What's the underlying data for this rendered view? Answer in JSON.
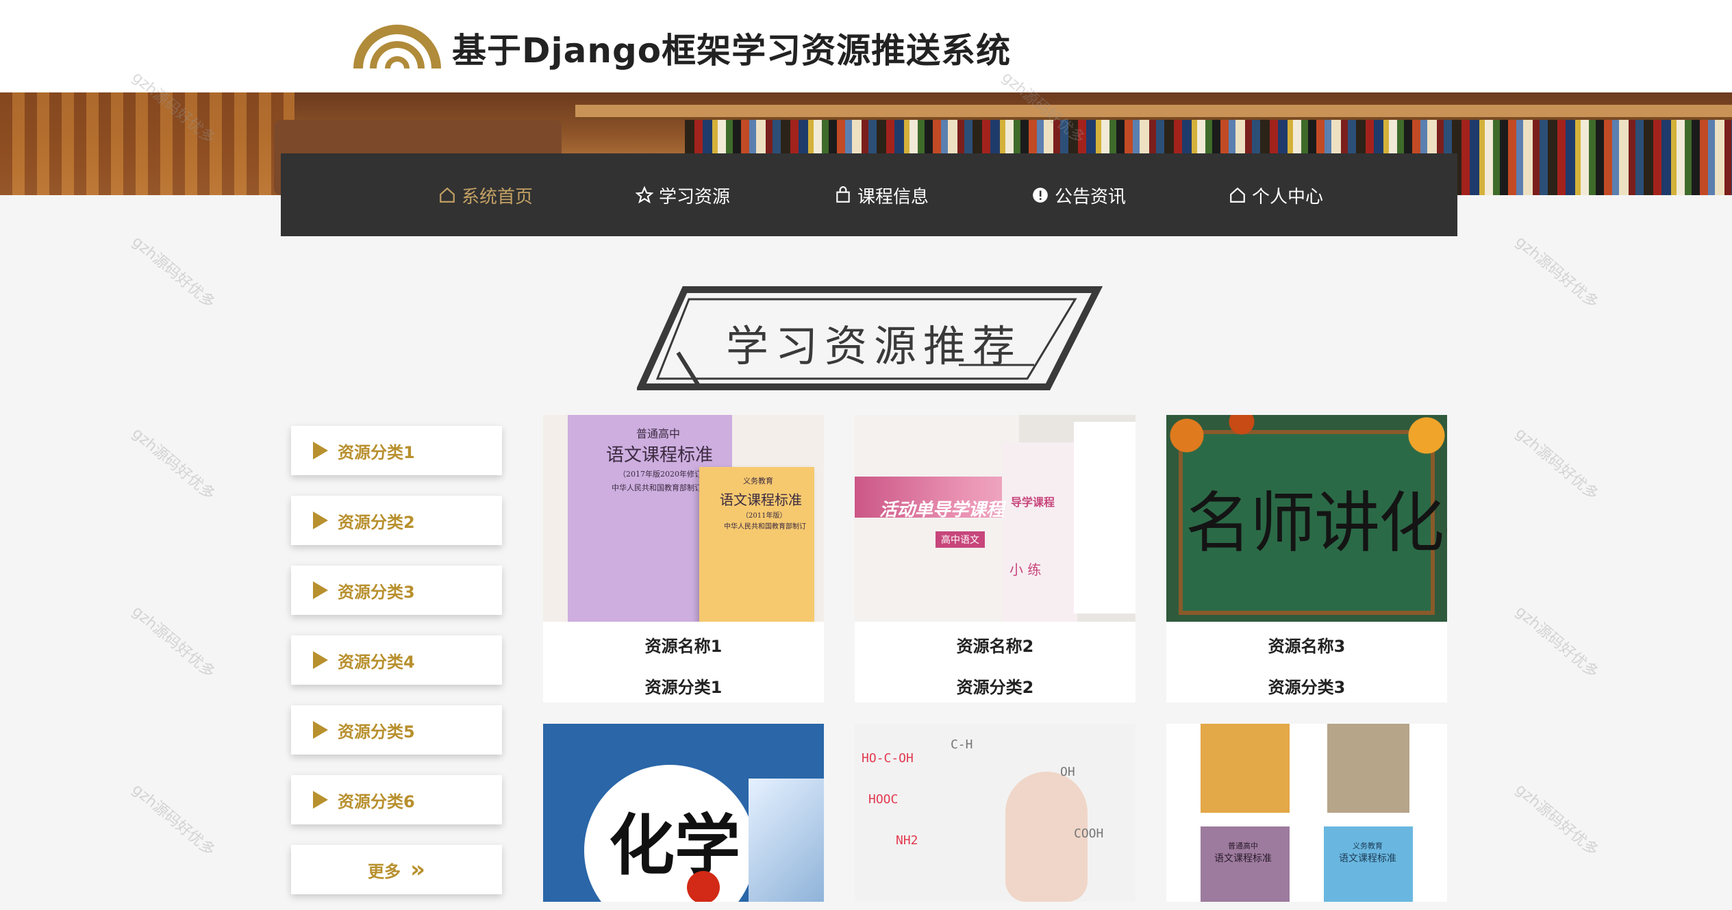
{
  "header": {
    "site_title": "基于Django框架学习资源推送系统"
  },
  "nav": {
    "items": [
      {
        "label": "系统首页",
        "icon": "home-icon",
        "active": true
      },
      {
        "label": "学习资源",
        "icon": "star-icon",
        "active": false
      },
      {
        "label": "课程信息",
        "icon": "bag-icon",
        "active": false
      },
      {
        "label": "公告资讯",
        "icon": "alert-circle-icon",
        "active": false
      },
      {
        "label": "个人中心",
        "icon": "home-icon",
        "active": false
      }
    ]
  },
  "section": {
    "title": "学习资源推荐"
  },
  "sidebar": {
    "items": [
      {
        "label": "资源分类1"
      },
      {
        "label": "资源分类2"
      },
      {
        "label": "资源分类3"
      },
      {
        "label": "资源分类4"
      },
      {
        "label": "资源分类5"
      },
      {
        "label": "资源分类6"
      }
    ],
    "more_label": "更多"
  },
  "cards": [
    {
      "name": "资源名称1",
      "category": "资源分类1",
      "image": {
        "book_a_lines": [
          "普通高中",
          "语文课程标准",
          "（2017年版2020年修订）",
          "中华人民共和国教育部制订"
        ],
        "book_b_lines": [
          "义务教育",
          "语文课程标准",
          "（2011年版）",
          "中华人民共和国教育部制订"
        ]
      }
    },
    {
      "name": "资源名称2",
      "category": "资源分类2",
      "image": {
        "cover_title": "活动单导学课程",
        "cover_sub": "高中语文",
        "right_title": "导学课程",
        "right_sub": "小 练"
      }
    },
    {
      "name": "资源名称3",
      "category": "资源分类3",
      "image": {
        "chalk_text": "名师讲化学"
      }
    }
  ],
  "cards_row2": [
    {
      "image": {
        "big_text": "化学"
      }
    },
    {
      "image": {
        "formulas": [
          "HO-C-OH",
          "C-H",
          "HOOC",
          "OH",
          "NH2",
          "COOH"
        ]
      }
    },
    {
      "image": {
        "book_lines": [
          "普通高中",
          "语文课程标准",
          "义务教育",
          "语文课程标准"
        ]
      }
    }
  ],
  "watermark": "gzh源码好优多",
  "colors": {
    "accent": "#b8902e",
    "nav_active": "#c4a164",
    "nav_bg": "#323232"
  }
}
